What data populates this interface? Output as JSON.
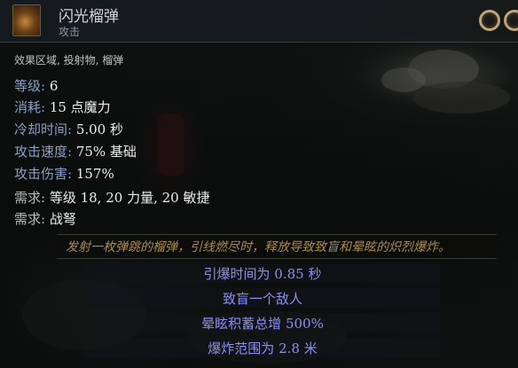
{
  "skill": {
    "name": "闪光榴弹",
    "type": "攻击",
    "tags": "效果区域, 投射物, 榴弹",
    "icon": "flash-grenade-icon"
  },
  "stats": [
    {
      "label": "等级: ",
      "value": "6"
    },
    {
      "label": "消耗: ",
      "value": "15 点魔力"
    },
    {
      "label": "冷却时间: ",
      "value": "5.00 秒"
    },
    {
      "label": "攻击速度: ",
      "value": "75% 基础"
    },
    {
      "label": "攻击伤害: ",
      "value": "157%"
    }
  ],
  "requirements": [
    {
      "label": "需求: ",
      "value": "等级 18, 20 力量, 20 敏捷"
    },
    {
      "label": "需求: ",
      "value": "战弩"
    }
  ],
  "description": "发射一枚弹跳的榴弹，引线燃尽时，释放导致致盲和晕眩的炽烈爆炸。",
  "modifiers": [
    "引爆时间为 0.85 秒",
    "致盲一个敌人",
    "晕眩积蓄总增 500%",
    "爆炸范围为 2.8 米"
  ],
  "colors": {
    "stat_label": "#8a9fc2",
    "modifier": "#8a8ff0",
    "description": "#a88b4f",
    "socket_ring": "#bda47a"
  }
}
